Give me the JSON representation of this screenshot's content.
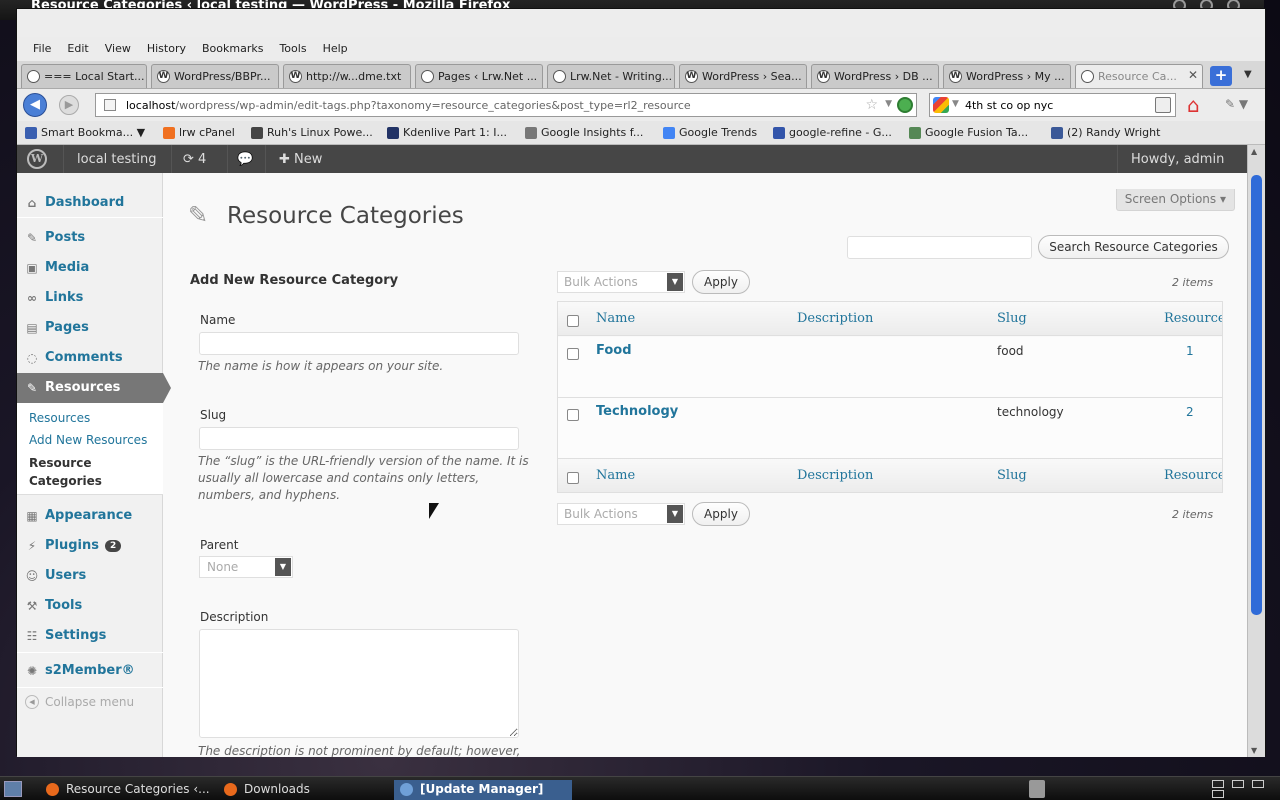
{
  "window": {
    "title": "Resource Categories ‹ local testing — WordPress - Mozilla Firefox"
  },
  "menubar": [
    "File",
    "Edit",
    "View",
    "History",
    "Bookmarks",
    "Tools",
    "Help"
  ],
  "tabs": [
    {
      "label": "=== Local Start...",
      "icon": "page-icon"
    },
    {
      "label": "WordPress/BBPr...",
      "icon": "wordpress-icon"
    },
    {
      "label": "http://w...dme.txt",
      "icon": "wordpress-icon"
    },
    {
      "label": "Pages ‹ Lrw.Net ...",
      "icon": "page-icon"
    },
    {
      "label": "Lrw.Net - Writing...",
      "icon": "page-icon"
    },
    {
      "label": "WordPress › Sea...",
      "icon": "wordpress-icon"
    },
    {
      "label": "WordPress › DB ...",
      "icon": "wordpress-icon"
    },
    {
      "label": "WordPress › My ...",
      "icon": "wordpress-icon"
    },
    {
      "label": "Resource Ca...",
      "icon": "page-icon",
      "active": true
    }
  ],
  "navbar": {
    "url_host": "localhost",
    "url_path": "/wordpress/wp-admin/edit-tags.php?taxonomy=resource_categories&post_type=rl2_resource",
    "search_value": "4th st co op nyc"
  },
  "bookmarks": [
    {
      "label": "Smart Bookma...",
      "color": "#3a5fb0"
    },
    {
      "label": "lrw cPanel",
      "color": "#f07020"
    },
    {
      "label": "Ruh's Linux Powe...",
      "color": "#444444"
    },
    {
      "label": "Kdenlive Part 1: I...",
      "color": "#223366"
    },
    {
      "label": "Google Insights f...",
      "color": "#777777"
    },
    {
      "label": "Google Trends",
      "color": "#4285f4"
    },
    {
      "label": "google-refine - G...",
      "color": "#3355aa"
    },
    {
      "label": "Google Fusion Ta...",
      "color": "#558855"
    },
    {
      "label": "(2) Randy Wright",
      "color": "#3b5998"
    }
  ],
  "adminbar": {
    "site": "local testing",
    "updates": "4",
    "new": "New",
    "howdy": "Howdy, admin"
  },
  "sidebar": {
    "items": [
      {
        "label": "Dashboard",
        "icon": "dashboard-icon"
      },
      {
        "label": "Posts",
        "icon": "pushpin-icon"
      },
      {
        "label": "Media",
        "icon": "media-icon"
      },
      {
        "label": "Links",
        "icon": "link-icon"
      },
      {
        "label": "Pages",
        "icon": "pages-icon"
      },
      {
        "label": "Comments",
        "icon": "comments-icon"
      },
      {
        "label": "Resources",
        "icon": "pushpin-icon"
      },
      {
        "label": "Appearance",
        "icon": "appearance-icon"
      },
      {
        "label": "Plugins",
        "icon": "plugins-icon",
        "badge": "2"
      },
      {
        "label": "Users",
        "icon": "users-icon"
      },
      {
        "label": "Tools",
        "icon": "tools-icon"
      },
      {
        "label": "Settings",
        "icon": "settings-icon"
      },
      {
        "label": "s2Member®",
        "icon": "s2member-icon"
      }
    ],
    "submenu": [
      "Resources",
      "Add New Resources",
      "Resource Categories"
    ],
    "collapse": "Collapse menu"
  },
  "page": {
    "title": "Resource Categories",
    "screen_options": "Screen Options",
    "search_button": "Search Resource Categories",
    "search_value": ""
  },
  "form": {
    "heading": "Add New Resource Category",
    "name_label": "Name",
    "name_value": "",
    "name_help": "The name is how it appears on your site.",
    "slug_label": "Slug",
    "slug_value": "",
    "slug_help": "The “slug” is the URL-friendly version of the name. It is usually all lowercase and contains only letters, numbers, and hyphens.",
    "parent_label": "Parent",
    "parent_value": "None",
    "description_label": "Description",
    "description_value": "",
    "description_help": "The description is not prominent by default; however,"
  },
  "table": {
    "bulk_actions": "Bulk Actions",
    "apply": "Apply",
    "item_count": "2 items",
    "columns": [
      "Name",
      "Description",
      "Slug",
      "Resources"
    ],
    "rows": [
      {
        "name": "Food",
        "description": "",
        "slug": "food",
        "count": "1"
      },
      {
        "name": "Technology",
        "description": "",
        "slug": "technology",
        "count": "2"
      }
    ]
  },
  "taskbar": [
    {
      "label": "Resource Categories ‹...",
      "icon": "firefox-icon"
    },
    {
      "label": "Downloads",
      "icon": "firefox-icon"
    },
    {
      "label": "[Update Manager]",
      "icon": "update-icon"
    }
  ]
}
